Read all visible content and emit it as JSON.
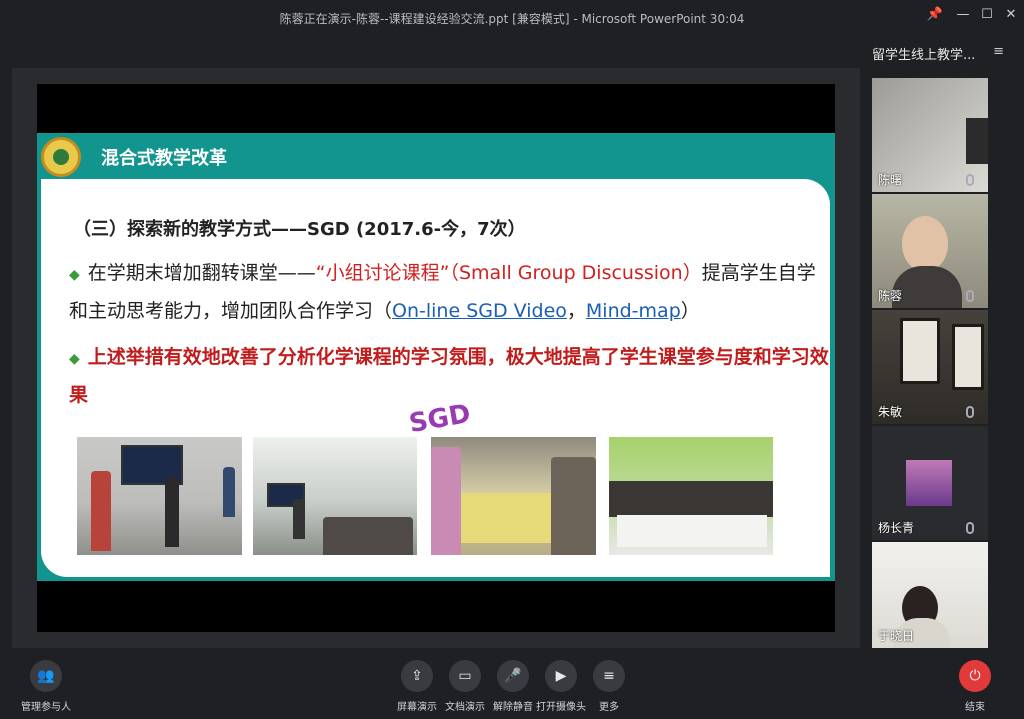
{
  "window": {
    "title": "陈蓉正在演示-陈蓉--课程建设经验交流.ppt [兼容模式] - Microsoft PowerPoint 30:04",
    "controls": {
      "pin": "📌",
      "minimize": "—",
      "maximize": "☐",
      "close": "✕"
    }
  },
  "slide": {
    "header_title": "混合式教学改革",
    "heading": "（三）探索新的教学方式——SGD (2017.6-今，7次）",
    "p1_prefix": "在学期末增加翻转课堂——",
    "p1_red": "“小组讨论课程”（Small Group Discussion）",
    "p1_middle": "提高学生自学和主动思考能力，增加团队合作学习（",
    "p1_link1": "On-line SGD Video",
    "p1_sep": "，",
    "p1_link2": "Mind-map",
    "p1_suffix": "）",
    "p2": "上述举措有效地改善了分析化学课程的学习氛围，极大地提高了学生课堂参与度和学习效果",
    "sgd_label": "SGD"
  },
  "sidebar": {
    "title": "留学生线上教学...",
    "participants": [
      {
        "name": "陈曙"
      },
      {
        "name": "陈蓉"
      },
      {
        "name": "朱敏"
      },
      {
        "name": "杨长青"
      },
      {
        "name": "于晓日"
      }
    ]
  },
  "toolbar": {
    "manage": "管理参与人",
    "screen_share": "屏幕演示",
    "doc_share": "文档演示",
    "unmute": "解除静音",
    "camera": "打开摄像头",
    "more": "更多",
    "end": "结束"
  },
  "colors": {
    "accent_teal": "#12958f",
    "red_text": "#c11c1c",
    "end_red": "#e23a3a"
  }
}
